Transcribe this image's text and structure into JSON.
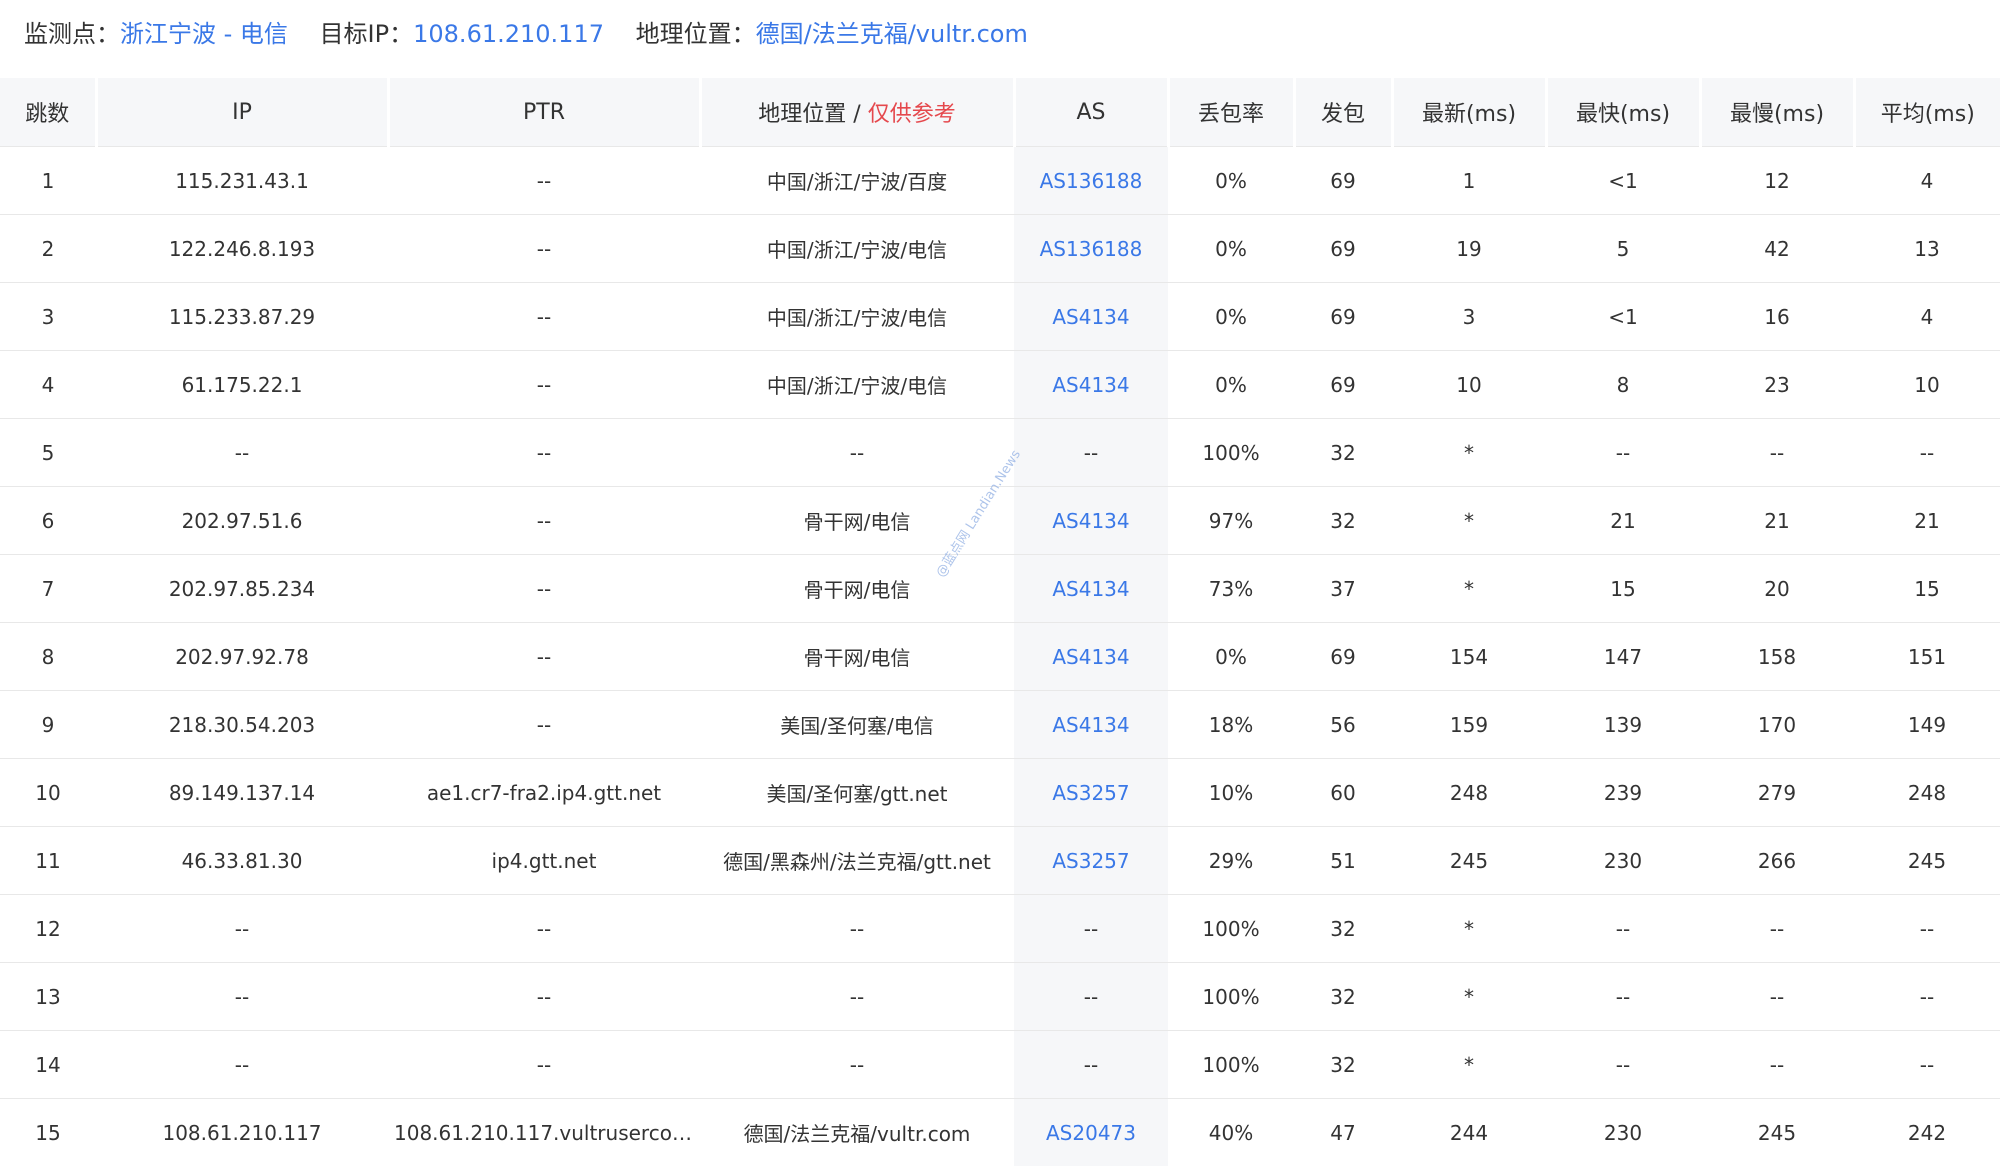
{
  "header": {
    "monitor_label": "监测点：",
    "monitor_value": "浙江宁波 - 电信",
    "target_label": "目标IP：",
    "target_value": "108.61.210.117",
    "geo_label": "地理位置：",
    "geo_value": "德国/法兰克福/vultr.com"
  },
  "columns": {
    "hop": "跳数",
    "ip": "IP",
    "ptr": "PTR",
    "geo_prefix": "地理位置 / ",
    "geo_warn": "仅供参考",
    "as": "AS",
    "loss": "丢包率",
    "sent": "发包",
    "last": "最新(ms)",
    "best": "最快(ms)",
    "worst": "最慢(ms)",
    "avg": "平均(ms)"
  },
  "rows": [
    {
      "hop": "1",
      "ip": "115.231.43.1",
      "ptr": "--",
      "geo": "中国/浙江/宁波/百度",
      "as": "AS136188",
      "loss": "0%",
      "sent": "69",
      "last": "1",
      "best": "<1",
      "worst": "12",
      "avg": "4"
    },
    {
      "hop": "2",
      "ip": "122.246.8.193",
      "ptr": "--",
      "geo": "中国/浙江/宁波/电信",
      "as": "AS136188",
      "loss": "0%",
      "sent": "69",
      "last": "19",
      "best": "5",
      "worst": "42",
      "avg": "13"
    },
    {
      "hop": "3",
      "ip": "115.233.87.29",
      "ptr": "--",
      "geo": "中国/浙江/宁波/电信",
      "as": "AS4134",
      "loss": "0%",
      "sent": "69",
      "last": "3",
      "best": "<1",
      "worst": "16",
      "avg": "4"
    },
    {
      "hop": "4",
      "ip": "61.175.22.1",
      "ptr": "--",
      "geo": "中国/浙江/宁波/电信",
      "as": "AS4134",
      "loss": "0%",
      "sent": "69",
      "last": "10",
      "best": "8",
      "worst": "23",
      "avg": "10"
    },
    {
      "hop": "5",
      "ip": "--",
      "ptr": "--",
      "geo": "--",
      "as": "--",
      "loss": "100%",
      "sent": "32",
      "last": "*",
      "best": "--",
      "worst": "--",
      "avg": "--"
    },
    {
      "hop": "6",
      "ip": "202.97.51.6",
      "ptr": "--",
      "geo": "骨干网/电信",
      "as": "AS4134",
      "loss": "97%",
      "sent": "32",
      "last": "*",
      "best": "21",
      "worst": "21",
      "avg": "21"
    },
    {
      "hop": "7",
      "ip": "202.97.85.234",
      "ptr": "--",
      "geo": "骨干网/电信",
      "as": "AS4134",
      "loss": "73%",
      "sent": "37",
      "last": "*",
      "best": "15",
      "worst": "20",
      "avg": "15"
    },
    {
      "hop": "8",
      "ip": "202.97.92.78",
      "ptr": "--",
      "geo": "骨干网/电信",
      "as": "AS4134",
      "loss": "0%",
      "sent": "69",
      "last": "154",
      "best": "147",
      "worst": "158",
      "avg": "151"
    },
    {
      "hop": "9",
      "ip": "218.30.54.203",
      "ptr": "--",
      "geo": "美国/圣何塞/电信",
      "as": "AS4134",
      "loss": "18%",
      "sent": "56",
      "last": "159",
      "best": "139",
      "worst": "170",
      "avg": "149"
    },
    {
      "hop": "10",
      "ip": "89.149.137.14",
      "ptr": "ae1.cr7-fra2.ip4.gtt.net",
      "geo": "美国/圣何塞/gtt.net",
      "as": "AS3257",
      "loss": "10%",
      "sent": "60",
      "last": "248",
      "best": "239",
      "worst": "279",
      "avg": "248"
    },
    {
      "hop": "11",
      "ip": "46.33.81.30",
      "ptr": "ip4.gtt.net",
      "geo": "德国/黑森州/法兰克福/gtt.net",
      "as": "AS3257",
      "loss": "29%",
      "sent": "51",
      "last": "245",
      "best": "230",
      "worst": "266",
      "avg": "245"
    },
    {
      "hop": "12",
      "ip": "--",
      "ptr": "--",
      "geo": "--",
      "as": "--",
      "loss": "100%",
      "sent": "32",
      "last": "*",
      "best": "--",
      "worst": "--",
      "avg": "--"
    },
    {
      "hop": "13",
      "ip": "--",
      "ptr": "--",
      "geo": "--",
      "as": "--",
      "loss": "100%",
      "sent": "32",
      "last": "*",
      "best": "--",
      "worst": "--",
      "avg": "--"
    },
    {
      "hop": "14",
      "ip": "--",
      "ptr": "--",
      "geo": "--",
      "as": "--",
      "loss": "100%",
      "sent": "32",
      "last": "*",
      "best": "--",
      "worst": "--",
      "avg": "--"
    },
    {
      "hop": "15",
      "ip": "108.61.210.117",
      "ptr": "108.61.210.117.vultrusercont...",
      "geo": "德国/法兰克福/vultr.com",
      "as": "AS20473",
      "loss": "40%",
      "sent": "47",
      "last": "244",
      "best": "230",
      "worst": "245",
      "avg": "242"
    }
  ],
  "watermark": "@蓝点网 Landian.News"
}
